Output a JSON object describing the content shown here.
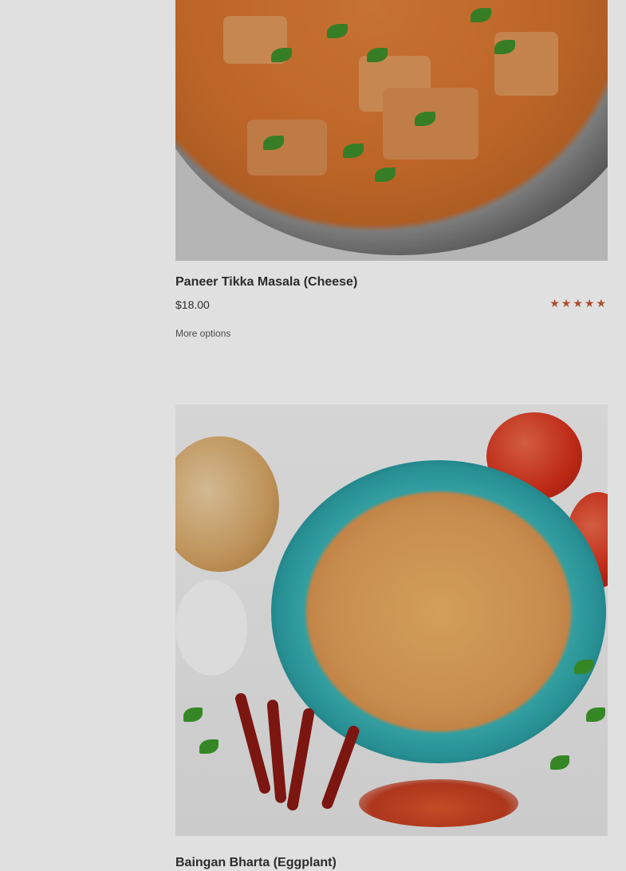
{
  "products": [
    {
      "name": "Paneer Tikka Masala (Cheese)",
      "price": "$18.00",
      "rating": 5,
      "action": "More options"
    },
    {
      "name": "Baingan Bharta (Eggplant)"
    }
  ]
}
